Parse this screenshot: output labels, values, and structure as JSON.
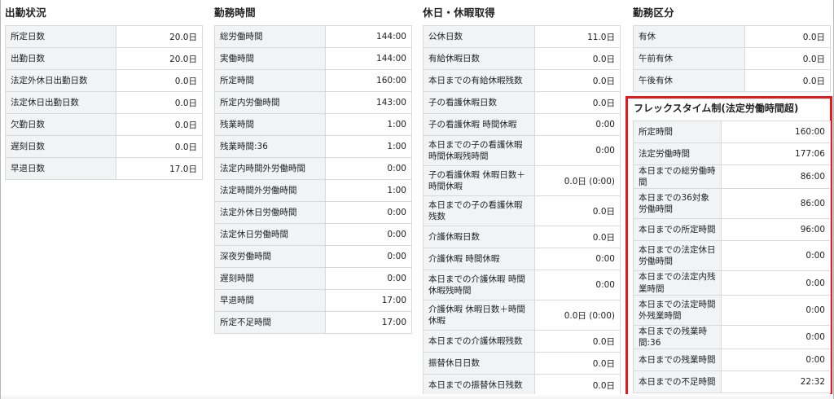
{
  "col1": {
    "title": "出勤状況",
    "rows": [
      {
        "label": "所定日数",
        "value": "20.0日"
      },
      {
        "label": "出勤日数",
        "value": "20.0日"
      },
      {
        "label": "法定外休日出勤日数",
        "value": "0.0日"
      },
      {
        "label": "法定休日出勤日数",
        "value": "0.0日"
      },
      {
        "label": "欠勤日数",
        "value": "0.0日"
      },
      {
        "label": "遅刻日数",
        "value": "0.0日"
      },
      {
        "label": "早退日数",
        "value": "17.0日"
      }
    ]
  },
  "col2": {
    "title": "勤務時間",
    "rows": [
      {
        "label": "総労働時間",
        "value": "144:00"
      },
      {
        "label": "実働時間",
        "value": "144:00"
      },
      {
        "label": "所定時間",
        "value": "160:00"
      },
      {
        "label": "所定内労働時間",
        "value": "143:00"
      },
      {
        "label": "残業時間",
        "value": "1:00"
      },
      {
        "label": "残業時間:36",
        "value": "1:00"
      },
      {
        "label": "法定内時間外労働時間",
        "value": "0:00"
      },
      {
        "label": "法定時間外労働時間",
        "value": "1:00"
      },
      {
        "label": "法定外休日労働時間",
        "value": "0:00"
      },
      {
        "label": "法定休日労働時間",
        "value": "0:00"
      },
      {
        "label": "深夜労働時間",
        "value": "0:00"
      },
      {
        "label": "遅刻時間",
        "value": "0:00"
      },
      {
        "label": "早退時間",
        "value": "17:00"
      },
      {
        "label": "所定不足時間",
        "value": "17:00"
      }
    ]
  },
  "col3": {
    "title": "休日・休暇取得",
    "rows": [
      {
        "label": "公休日数",
        "value": "11.0日"
      },
      {
        "label": "有給休暇日数",
        "value": "0.0日"
      },
      {
        "label": "本日までの有給休暇残数",
        "value": "0.0日"
      },
      {
        "label": "子の看護休暇日数",
        "value": "0.0日"
      },
      {
        "label": "子の看護休暇 時間休暇",
        "value": "0:00"
      },
      {
        "label": "本日までの子の看護休暇時間休暇残時間",
        "value": "0:00"
      },
      {
        "label": "子の看護休暇 休暇日数＋時間休暇",
        "value": "0.0日 (0:00)"
      },
      {
        "label": "本日までの子の看護休暇残数",
        "value": "0.0日"
      },
      {
        "label": "介護休暇日数",
        "value": "0.0日"
      },
      {
        "label": "介護休暇 時間休暇",
        "value": "0:00"
      },
      {
        "label": "本日までの介護休暇 時間休暇残時間",
        "value": "0:00"
      },
      {
        "label": "介護休暇 休暇日数＋時間休暇",
        "value": "0.0日 (0:00)"
      },
      {
        "label": "本日までの介護休暇残数",
        "value": "0.0日"
      },
      {
        "label": "振替休日日数",
        "value": "0.0日"
      },
      {
        "label": "本日までの振替休日残数",
        "value": "0.0日"
      }
    ]
  },
  "col4": {
    "title": "勤務区分",
    "rows": [
      {
        "label": "有休",
        "value": "0.0日"
      },
      {
        "label": "午前有休",
        "value": "0.0日"
      },
      {
        "label": "午後有休",
        "value": "0.0日"
      }
    ]
  },
  "flex": {
    "title": "フレックスタイム制(法定労働時間超)",
    "rows": [
      {
        "label": "所定時間",
        "value": "160:00"
      },
      {
        "label": "法定労働時間",
        "value": "177:06"
      },
      {
        "label": "本日までの総労働時間",
        "value": "86:00"
      },
      {
        "label": "本日までの36対象労働時間",
        "value": "86:00"
      },
      {
        "label": "本日までの所定時間",
        "value": "96:00"
      },
      {
        "label": "本日までの法定休日労働時間",
        "value": "0:00"
      },
      {
        "label": "本日までの法定内残業時間",
        "value": "0:00"
      },
      {
        "label": "本日までの法定時間外残業時間",
        "value": "0:00"
      },
      {
        "label": "本日までの残業時間:36",
        "value": "0:00"
      },
      {
        "label": "本日までの残業時間",
        "value": "0:00"
      },
      {
        "label": "本日までの不足時間",
        "value": "22:32"
      }
    ]
  },
  "colors": {
    "highlight": "#e8191c",
    "label_bg": "#f2f3f5",
    "border": "#d9d9d9"
  }
}
